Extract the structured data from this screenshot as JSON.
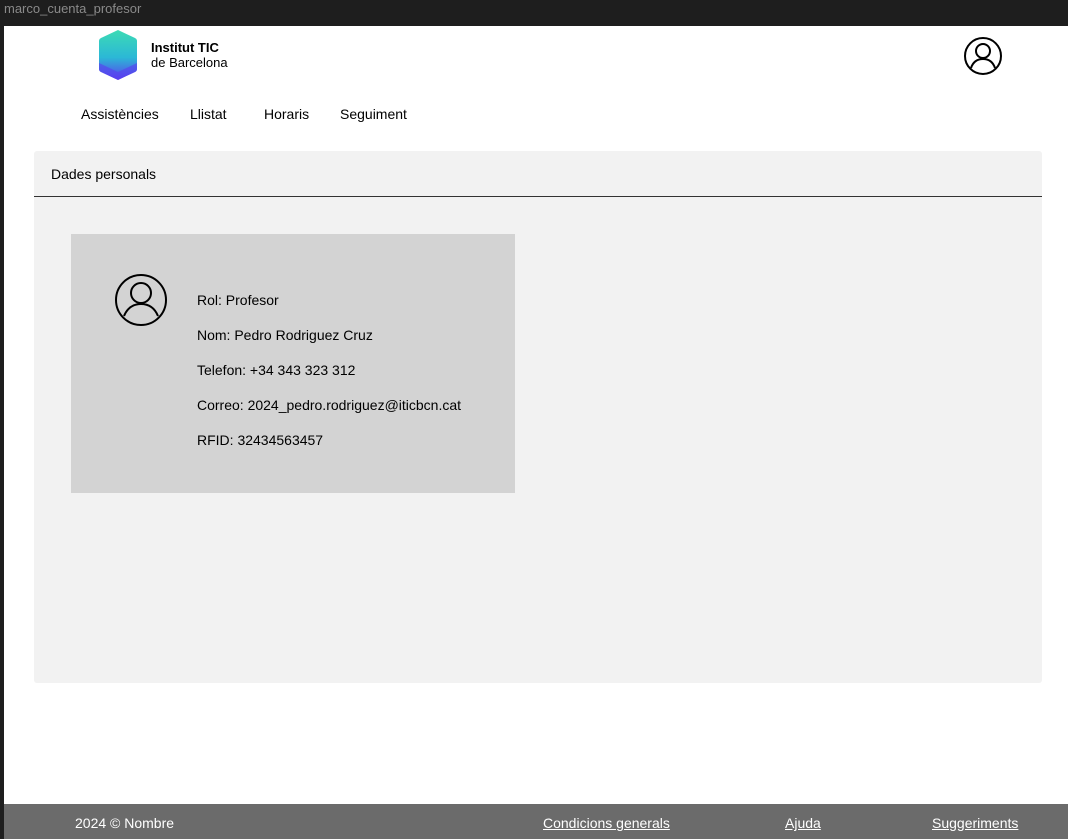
{
  "frame": {
    "title": "marco_cuenta_profesor"
  },
  "header": {
    "logo": {
      "line1": "Institut TIC",
      "line2": "de Barcelona"
    },
    "user_icon": "user-circle-icon"
  },
  "nav": {
    "items": [
      {
        "label": "Assistències"
      },
      {
        "label": "Llistat"
      },
      {
        "label": "Horaris"
      },
      {
        "label": "Seguiment"
      }
    ]
  },
  "panel": {
    "title": "Dades personals",
    "card": {
      "avatar_icon": "user-circle-icon",
      "fields": [
        "Rol: Profesor",
        "Nom: Pedro Rodriguez Cruz",
        "Telefon: +34 343 323 312",
        "Correo: 2024_pedro.rodriguez@iticbcn.cat",
        "RFID: 32434563457"
      ]
    }
  },
  "footer": {
    "copyright": "2024 © Nombre",
    "links": [
      {
        "label": "Condicions generals"
      },
      {
        "label": "Ajuda"
      },
      {
        "label": "Suggeriments"
      }
    ]
  },
  "colors": {
    "frame_bg": "#1e1e1e",
    "panel_bg": "#f2f2f2",
    "card_bg": "#d3d3d3",
    "footer_bg": "#6b6b6b",
    "logo_gradient_top": "#3ddbb4",
    "logo_gradient_bottom": "#5a3df0"
  }
}
